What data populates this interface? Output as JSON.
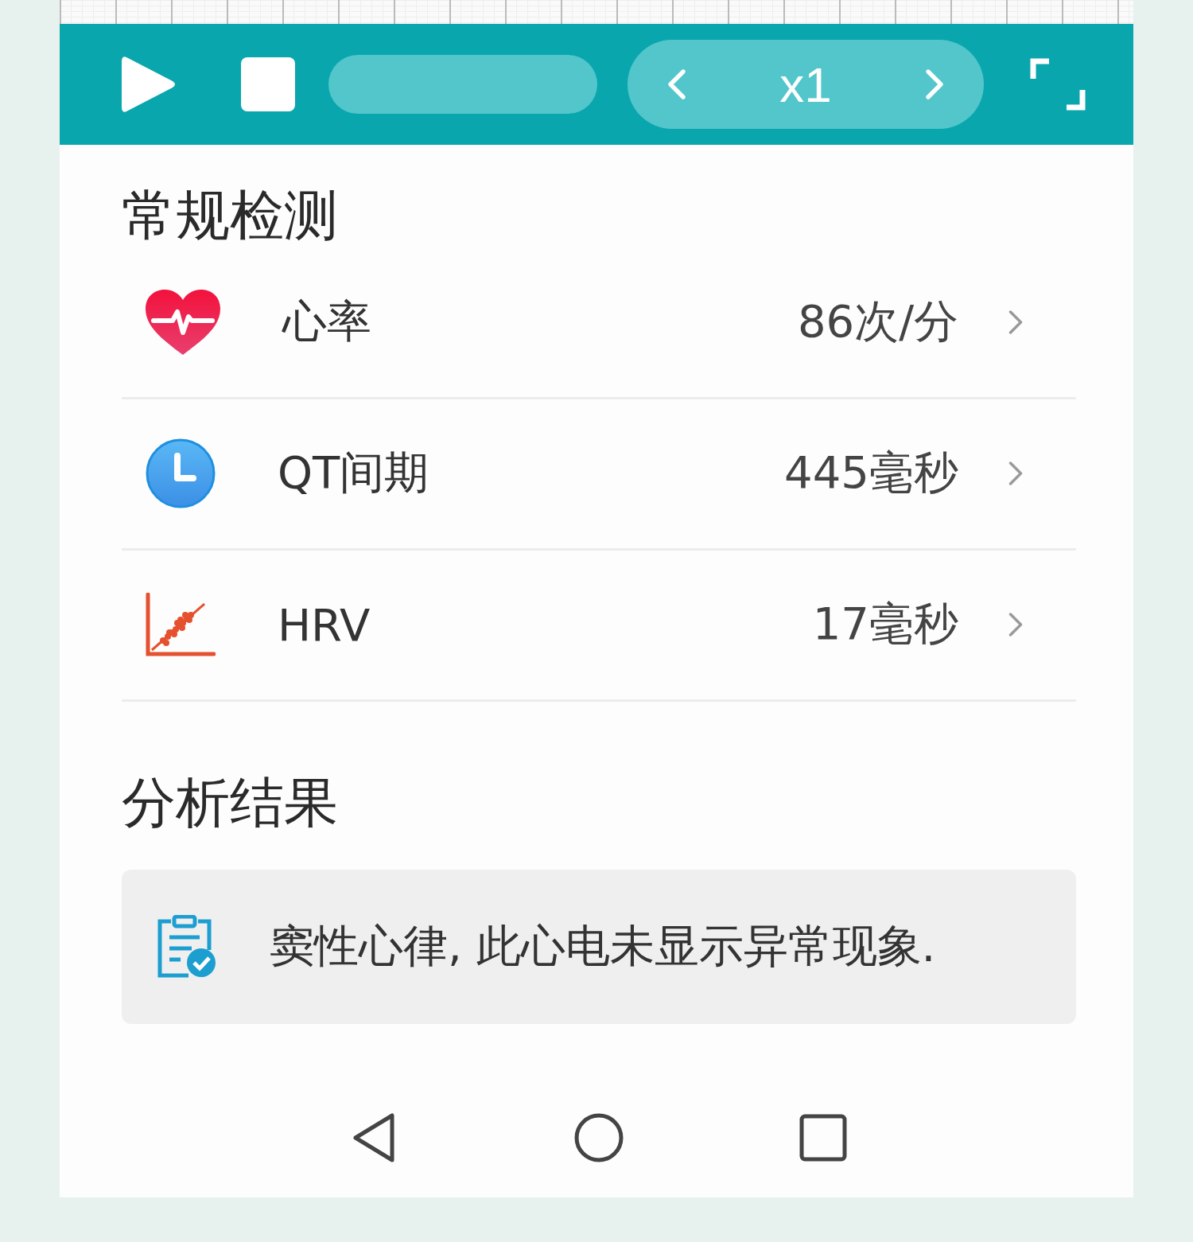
{
  "player": {
    "speed": "x1"
  },
  "sections": [
    {
      "title": "常规检测"
    },
    {
      "title": "分析结果"
    }
  ],
  "metrics": [
    {
      "kind": "heart",
      "label": "心率",
      "value": "86次/分"
    },
    {
      "kind": "clock",
      "label": "QT间期",
      "value": "445毫秒"
    },
    {
      "kind": "scatter",
      "label": "HRV",
      "value": "17毫秒"
    }
  ],
  "result": {
    "text": "窦性心律, 此心电未显示异常现象."
  }
}
